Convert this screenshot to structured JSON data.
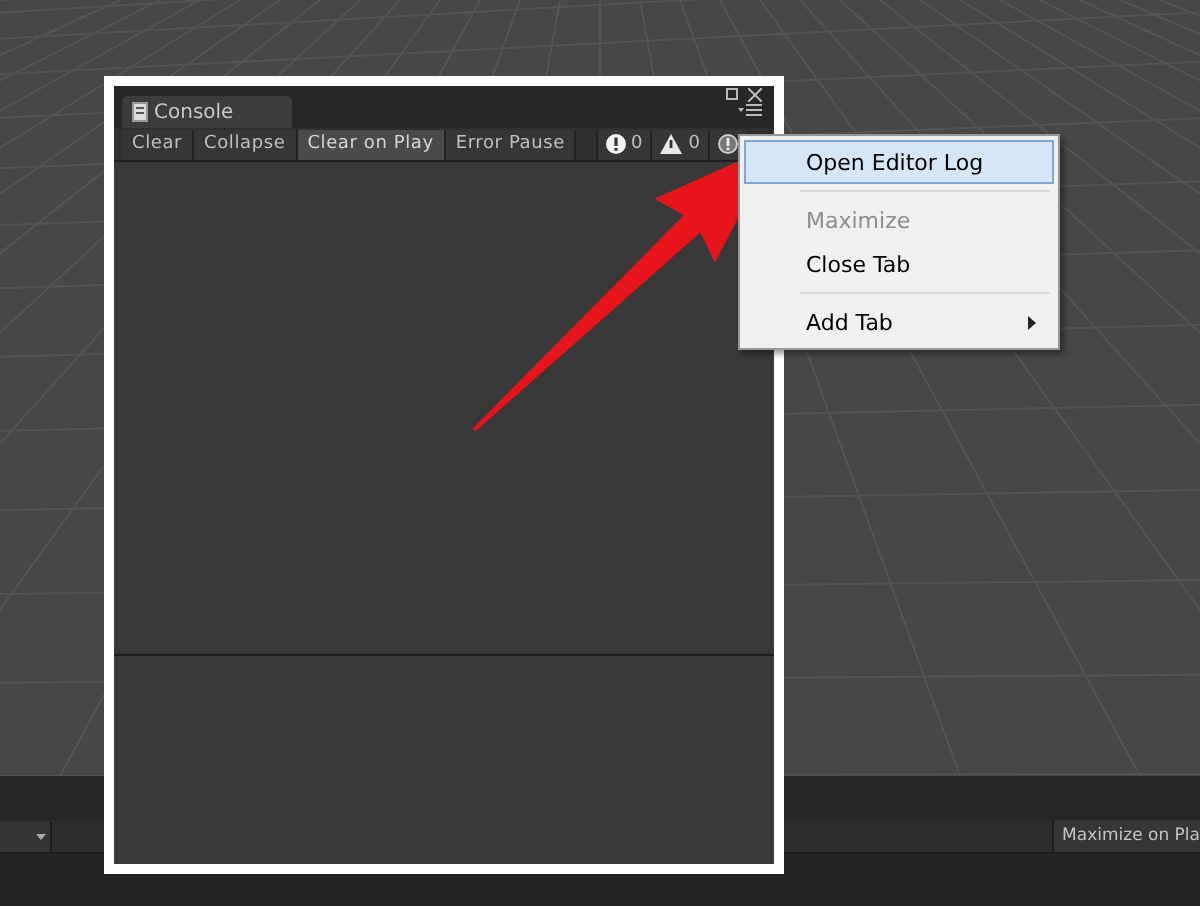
{
  "console": {
    "title": "Console",
    "toolbar": [
      {
        "label": "Clear",
        "selected": false
      },
      {
        "label": "Collapse",
        "selected": false
      },
      {
        "label": "Clear on Play",
        "selected": true
      },
      {
        "label": "Error Pause",
        "selected": false
      }
    ],
    "counts": [
      {
        "kind": "error",
        "count": "0"
      },
      {
        "kind": "warning",
        "count": "0"
      },
      {
        "kind": "info"
      }
    ]
  },
  "context_menu": {
    "items": [
      {
        "kind": "item",
        "label": "Open Editor Log",
        "selected": true,
        "disabled": false,
        "submenu": false
      },
      {
        "kind": "separator"
      },
      {
        "kind": "item",
        "label": "Maximize",
        "selected": false,
        "disabled": true,
        "submenu": false
      },
      {
        "kind": "item",
        "label": "Close Tab",
        "selected": false,
        "disabled": false,
        "submenu": false
      },
      {
        "kind": "separator"
      },
      {
        "kind": "item",
        "label": "Add Tab",
        "selected": false,
        "disabled": false,
        "submenu": true
      }
    ]
  },
  "bottom_toolbar": {
    "maximize_button": "Maximize on Pla"
  }
}
